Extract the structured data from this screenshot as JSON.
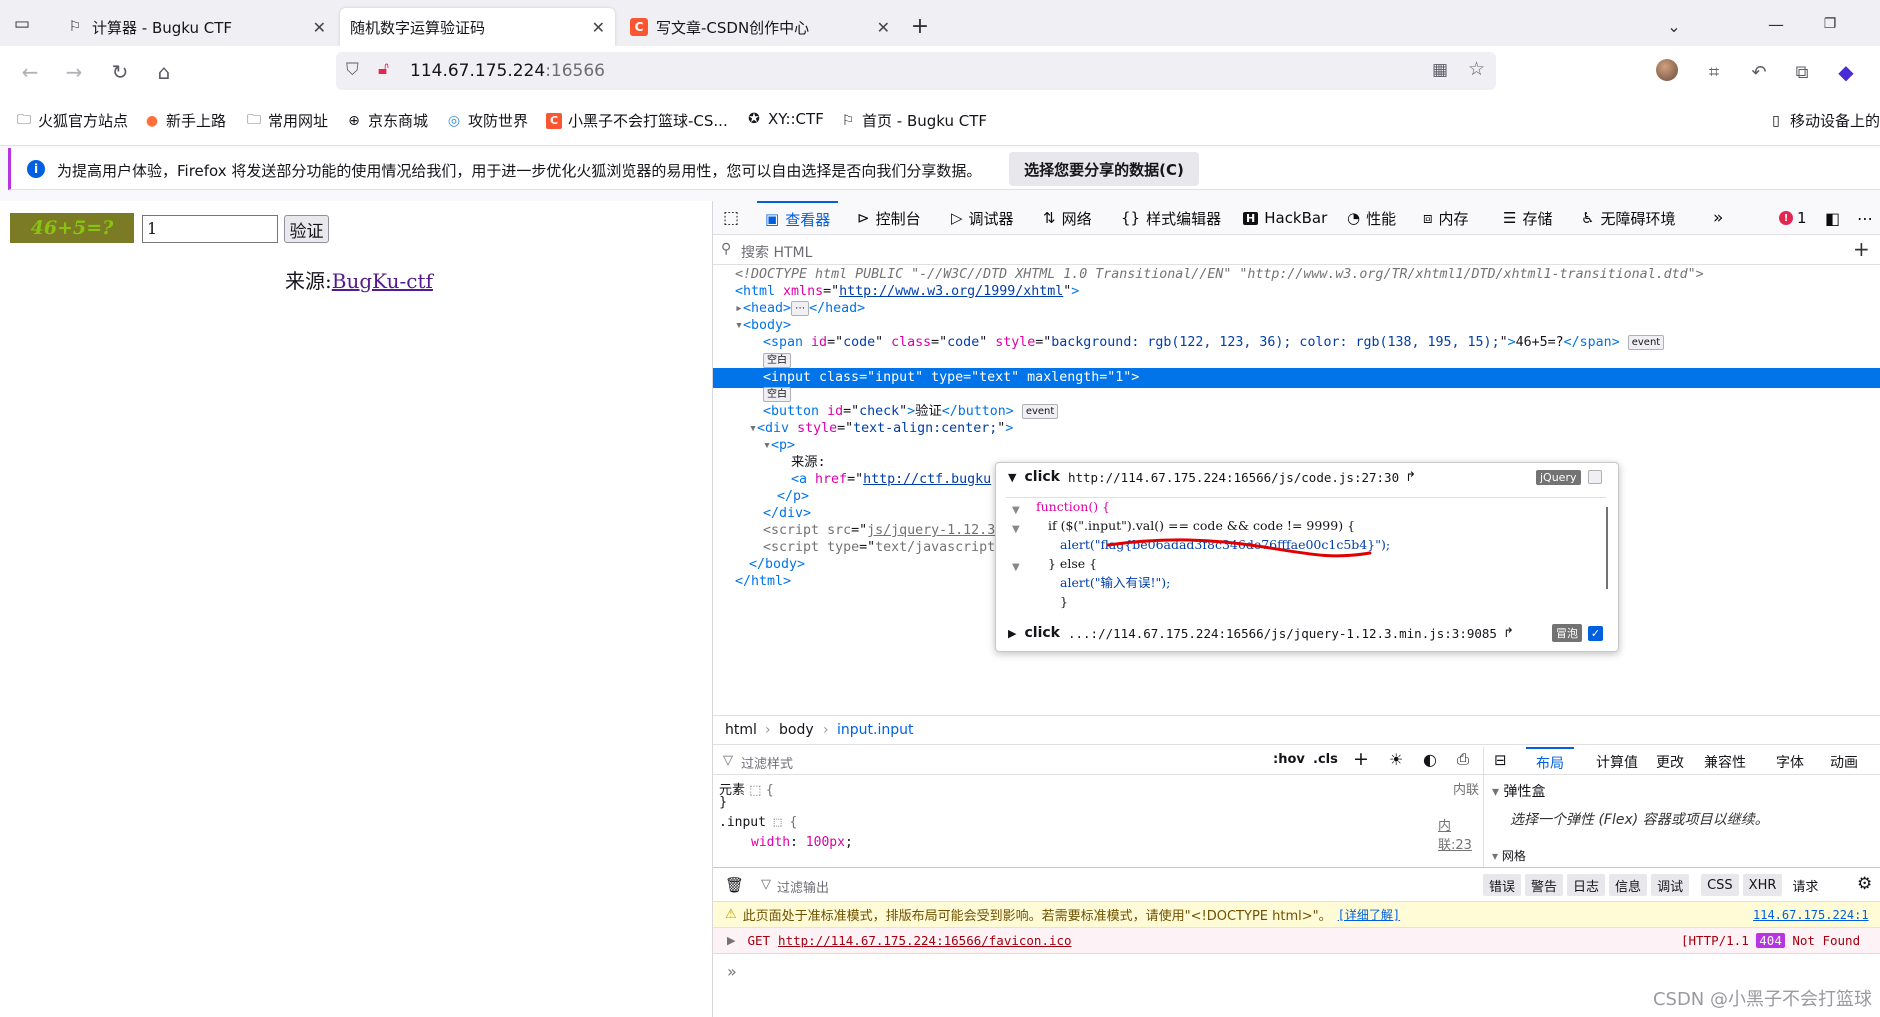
{
  "tabs": [
    {
      "label": "计算器 - Bugku CTF",
      "icon": "flag-icon",
      "active": false
    },
    {
      "label": "随机数字运算验证码",
      "icon": "",
      "active": true
    },
    {
      "label": "写文章-CSDN创作中心",
      "icon": "csdn-icon",
      "active": false
    }
  ],
  "nav": {
    "url_host": "114.67.175.224",
    "url_port": ":16566"
  },
  "bookmarks": [
    {
      "label": "火狐官方站点",
      "icon": "folder-icon"
    },
    {
      "label": "新手上路",
      "icon": "firefox-icon"
    },
    {
      "label": "常用网址",
      "icon": "folder-icon"
    },
    {
      "label": "京东商城",
      "icon": "globe-icon"
    },
    {
      "label": "攻防世界",
      "icon": "shield-icon"
    },
    {
      "label": "小黑子不会打篮球-CS...",
      "icon": "csdn-icon"
    },
    {
      "label": "XY::CTF",
      "icon": "ctf-icon"
    },
    {
      "label": "首页 - Bugku CTF",
      "icon": "flag-icon"
    },
    {
      "label": "移动设备上的书",
      "icon": "mobile-icon"
    }
  ],
  "notification": {
    "text": "为提高用户体验，Firefox 将发送部分功能的使用情况给我们，用于进一步优化火狐浏览器的易用性，您可以自由选择是否向我们分享数据。",
    "button": "选择您要分享的数据(C)"
  },
  "page": {
    "captcha": "46+5=?",
    "input_value": "1",
    "verify_button": "验证",
    "source_label": "来源:",
    "source_link": "BugKu-ctf"
  },
  "devtools": {
    "tabs": [
      "查看器",
      "控制台",
      "调试器",
      "网络",
      "样式编辑器",
      "HackBar",
      "性能",
      "内存",
      "存储",
      "无障碍环境"
    ],
    "error_count": "1",
    "search_placeholder": "搜索 HTML",
    "markup": {
      "doctype": "<!DOCTYPE html PUBLIC \"-//W3C//DTD XHTML 1.0 Transitional//EN\" \"http://www.w3.org/TR/xhtml1/DTD/xhtml1-transitional.dtd\">",
      "html_open": "<html",
      "xmlns_attr": "xmlns",
      "xmlns_val": "http://www.w3.org/1999/xhtml",
      "head": "<head>",
      "head_close": "</head>",
      "body": "<body>",
      "span_line": "46+5=?",
      "span_style": "background: rgb(122, 123, 36); color: rgb(138, 195, 15);",
      "whitespace_badge": "空白",
      "event_badge": "event",
      "input_line": "<input class=\"input\" type=\"text\" maxlength=\"1\">",
      "button_text": "验证",
      "div_style": "text-align:center;",
      "p_text": "来源:",
      "a_href": "http://ctf.bugku",
      "script1_src": "js/jquery-1.12.3",
      "script2_type": "text/javascript",
      "body_close": "</body>",
      "html_close": "</html>"
    },
    "event_popup": {
      "event1_type": "click",
      "event1_source": "http://114.67.175.224:16566/js/code.js:27:30",
      "jquery_badge": "jQuery",
      "code_line1": "function() {",
      "code_line2_a": "if ($(\".input\").val() == code && code != 9999) {",
      "code_line3": "alert(\"flag{be06adad3f8c346de76fffae00c1c5b4}\");",
      "code_line4": "} else {",
      "code_line5": "alert(\"输入有误!\");",
      "code_line6": "}",
      "event2_type": "click",
      "event2_source": "...://114.67.175.224:16566/js/jquery-1.12.3.min.js:3:9085",
      "bubble_badge": "冒泡"
    },
    "breadcrumbs": [
      "html",
      "body",
      "input.input"
    ],
    "rules": {
      "filter_placeholder": "过滤样式",
      "hov": ":hov",
      "cls": ".cls",
      "element_selector": "元素",
      "inline_label": "内联",
      "input_selector": ".input",
      "inline_ref": "内联:23",
      "prop": "width",
      "prop_val": "100px"
    },
    "layout_tabs": [
      "布局",
      "计算值",
      "更改",
      "兼容性",
      "字体",
      "动画"
    ],
    "flexbox_title": "弹性盒",
    "flexbox_hint": "选择一个弹性 (Flex) 容器或项目以继续。",
    "grid_title": "网格",
    "console": {
      "filter_placeholder": "过滤输出",
      "filters": [
        "错误",
        "警告",
        "日志",
        "信息",
        "调试"
      ],
      "filters2": [
        "CSS",
        "XHR",
        "请求"
      ],
      "warning": "此页面处于准标准模式，排版布局可能会受到影响。若需要标准模式，请使用\"<!DOCTYPE html>\"。",
      "warning_link": "[详细了解]",
      "warning_source": "114.67.175.224:1",
      "error_method": "GET",
      "error_url": "http://114.67.175.224:16566/favicon.ico",
      "error_status_a": "[HTTP/1.1",
      "error_code": "404",
      "error_status_b": "Not Found"
    }
  },
  "watermark": "CSDN @小黑子不会打篮球"
}
